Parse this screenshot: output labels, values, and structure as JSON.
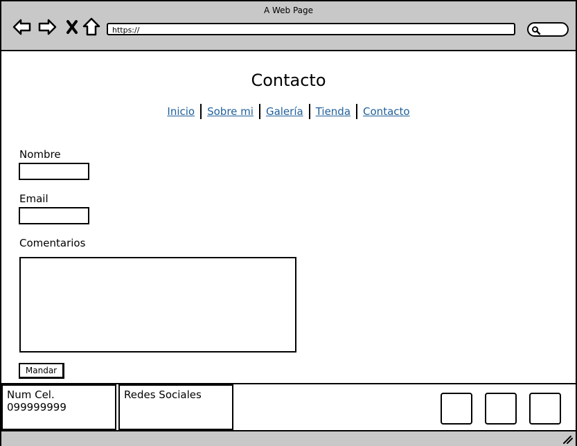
{
  "window": {
    "title": "A Web Page"
  },
  "browser": {
    "url": "https://",
    "icons": [
      "back-arrow-icon",
      "forward-arrow-icon",
      "close-x-icon",
      "home-icon",
      "search-icon",
      "resize-grip-icon"
    ]
  },
  "page": {
    "title": "Contacto",
    "nav": [
      "Inicio",
      "Sobre mi",
      "Galería",
      "Tienda",
      "Contacto"
    ],
    "link_color": "#1f5f99"
  },
  "form": {
    "name_label": "Nombre",
    "email_label": "Email",
    "comments_label": "Comentarios",
    "submit_label": "Mandar"
  },
  "footer": {
    "phone_label": "Num Cel.",
    "phone_number": "099999999",
    "social_label": "Redes Sociales"
  }
}
